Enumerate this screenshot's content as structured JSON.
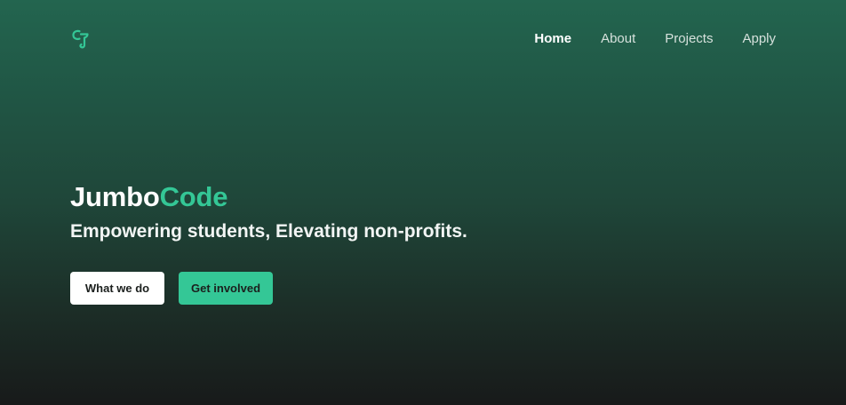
{
  "brand": {
    "logo_icon": "cj-logo-icon",
    "accent_color": "#34c796"
  },
  "nav": {
    "items": [
      {
        "label": "Home",
        "active": true
      },
      {
        "label": "About",
        "active": false
      },
      {
        "label": "Projects",
        "active": false
      },
      {
        "label": "Apply",
        "active": false
      }
    ]
  },
  "hero": {
    "title_part1": "Jumbo",
    "title_part2": "Code",
    "tagline": "Empowering students, Elevating non-profits."
  },
  "cta": {
    "primary_label": "What we do",
    "secondary_label": "Get involved"
  }
}
